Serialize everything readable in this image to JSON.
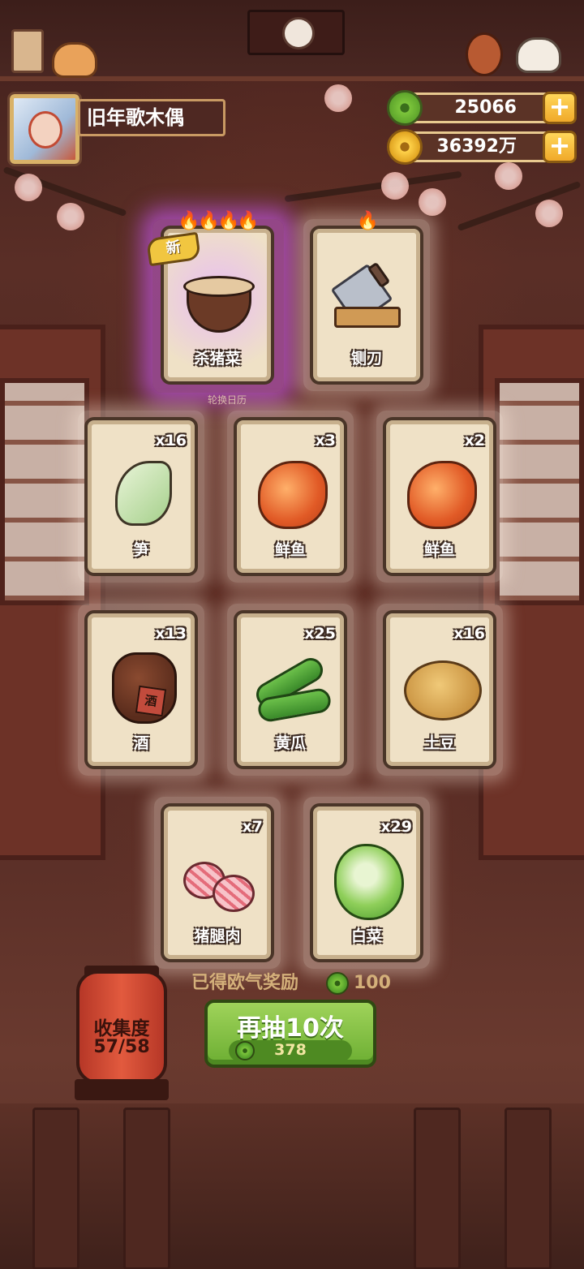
{
  "player": {
    "name": "旧年歌木偶"
  },
  "currency": {
    "jade": "25066",
    "coins": "36392万"
  },
  "top_cards": [
    {
      "label": "杀猪菜",
      "flames": 4,
      "badge": "新",
      "rarity": "purple"
    },
    {
      "label": "铡刀",
      "flames": 1,
      "badge": "",
      "rarity": "normal"
    }
  ],
  "hint_text": "轮换日历",
  "cards": [
    {
      "label": "笋",
      "count": "x16"
    },
    {
      "label": "鲜鱼",
      "count": "x3"
    },
    {
      "label": "鲜鱼",
      "count": "x2"
    },
    {
      "label": "酒",
      "count": "x13"
    },
    {
      "label": "黄瓜",
      "count": "x25"
    },
    {
      "label": "土豆",
      "count": "x16"
    },
    {
      "label": "猪腿肉",
      "count": "x7"
    },
    {
      "label": "白菜",
      "count": "x29"
    }
  ],
  "jar_text": "酒",
  "collection": {
    "title": "收集度",
    "value": "57/58"
  },
  "reward": {
    "label": "已得欧气奖励",
    "value": "100"
  },
  "draw_button": {
    "label": "再抽10次",
    "cost": "378"
  },
  "colors": {
    "accent_green": "#7cc53b",
    "gold": "#f1c640",
    "purple_glow": "#cd5aff"
  }
}
